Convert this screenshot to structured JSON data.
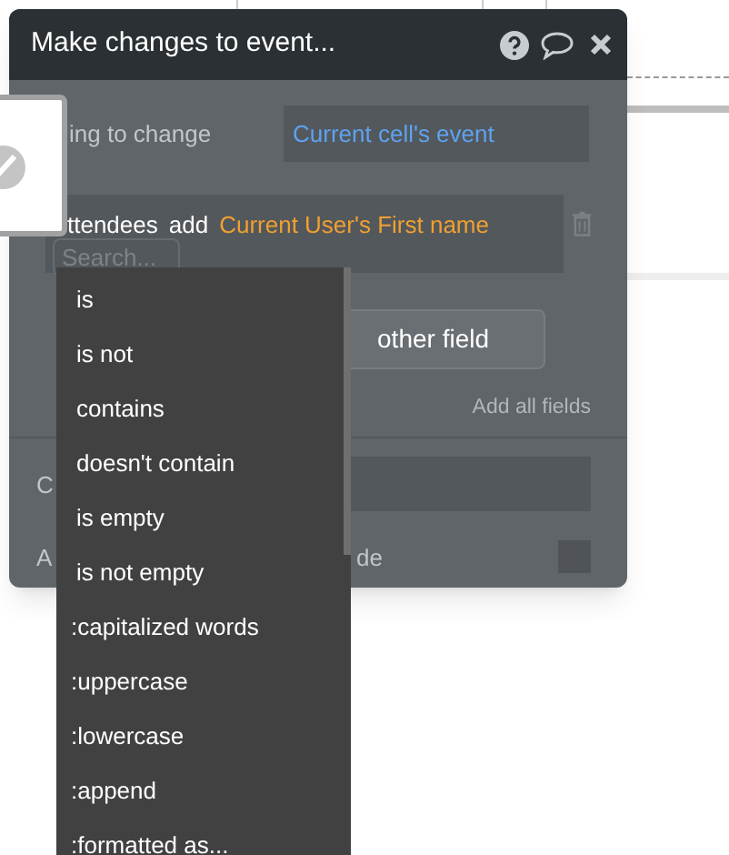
{
  "dialog": {
    "title": "Make changes to event...",
    "thing_row": {
      "label": "ing to change",
      "value": "Current cell's event"
    },
    "field_row": {
      "field": "ttendees",
      "operator": "add",
      "value": "Current User's First name",
      "search": {
        "placeholder": "Search..."
      }
    },
    "another_field_button": "other field",
    "add_all_link": "Add all fields",
    "condition_label": "C",
    "mode_label_start": "A",
    "mode_label_end": "de",
    "checkbox": {
      "checked": false
    }
  },
  "dropdown": {
    "items": [
      {
        "label": "is",
        "kind": "operator"
      },
      {
        "label": "is not",
        "kind": "operator"
      },
      {
        "label": "contains",
        "kind": "operator"
      },
      {
        "label": "doesn't contain",
        "kind": "operator"
      },
      {
        "label": "is empty",
        "kind": "operator"
      },
      {
        "label": "is not empty",
        "kind": "operator"
      },
      {
        "label": ":capitalized words",
        "kind": "modifier"
      },
      {
        "label": ":uppercase",
        "kind": "modifier"
      },
      {
        "label": ":lowercase",
        "kind": "modifier"
      },
      {
        "label": ":append",
        "kind": "modifier"
      },
      {
        "label": ":formatted as...",
        "kind": "modifier"
      }
    ]
  }
}
